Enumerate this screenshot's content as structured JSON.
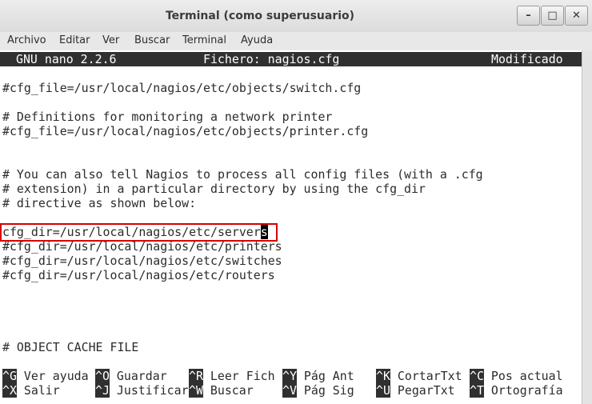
{
  "window": {
    "title": "Terminal (como superusuario)",
    "controls": {
      "minimize": "–",
      "maximize": "□",
      "close": "✕"
    }
  },
  "menubar": [
    "Archivo",
    "Editar",
    "Ver",
    "Buscar",
    "Terminal",
    "Ayuda"
  ],
  "nano": {
    "version": "GNU nano 2.2.6",
    "file": "Fichero: nagios.cfg",
    "state": "Modificado"
  },
  "editor_lines": {
    "l1": "#cfg_file=/usr/local/nagios/etc/objects/switch.cfg",
    "l2": "# Definitions for monitoring a network printer",
    "l3": "#cfg_file=/usr/local/nagios/etc/objects/printer.cfg",
    "l4": "# You can also tell Nagios to process all config files (with a .cfg",
    "l5": "# extension) in a particular directory by using the cfg_dir",
    "l6": "# directive as shown below:",
    "l7_before_cursor": "cfg_dir=/usr/local/nagios/etc/server",
    "l7_cursor_char": "s",
    "l8": "#cfg_dir=/usr/local/nagios/etc/printers",
    "l9": "#cfg_dir=/usr/local/nagios/etc/switches",
    "l10": "#cfg_dir=/usr/local/nagios/etc/routers",
    "l11": "# OBJECT CACHE FILE"
  },
  "shortcuts": [
    {
      "key": "^G",
      "label": "Ver ayuda"
    },
    {
      "key": "^O",
      "label": "Guardar"
    },
    {
      "key": "^R",
      "label": "Leer Fich"
    },
    {
      "key": "^Y",
      "label": "Pág Ant"
    },
    {
      "key": "^K",
      "label": "CortarTxt"
    },
    {
      "key": "^C",
      "label": "Pos actual"
    },
    {
      "key": "^X",
      "label": "Salir"
    },
    {
      "key": "^J",
      "label": "Justificar"
    },
    {
      "key": "^W",
      "label": "Buscar"
    },
    {
      "key": "^V",
      "label": "Pág Sig"
    },
    {
      "key": "^U",
      "label": "PegarTxt"
    },
    {
      "key": "^T",
      "label": "Ortografía"
    }
  ]
}
